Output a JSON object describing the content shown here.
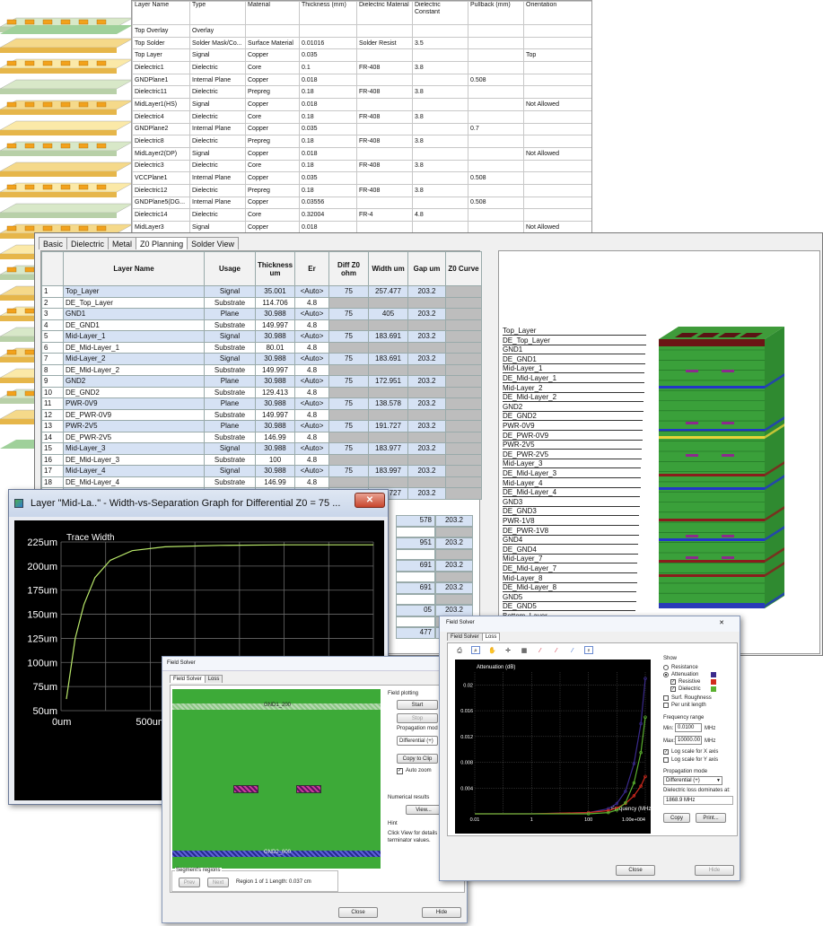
{
  "top_table": {
    "headers": [
      "Layer Name",
      "Type",
      "Material",
      "Thickness (mm)",
      "Dielectric Material",
      "Dielectric Constant",
      "Pullback (mm)",
      "Orientation"
    ],
    "rows": [
      [
        "Top Overlay",
        "Overlay",
        "",
        "",
        "",
        "",
        "",
        ""
      ],
      [
        "Top Solder",
        "Solder Mask/Co...",
        "Surface Material",
        "0.01016",
        "Solder Resist",
        "3.5",
        "",
        ""
      ],
      [
        "Top Layer",
        "Signal",
        "Copper",
        "0.035",
        "",
        "",
        "",
        "Top"
      ],
      [
        "Dielectric1",
        "Dielectric",
        "Core",
        "0.1",
        "FR-408",
        "3.8",
        "",
        ""
      ],
      [
        "GNDPlane1",
        "Internal Plane",
        "Copper",
        "0.018",
        "",
        "",
        "0.508",
        ""
      ],
      [
        "Dielectric11",
        "Dielectric",
        "Prepreg",
        "0.18",
        "FR-408",
        "3.8",
        "",
        ""
      ],
      [
        "MidLayer1(HS)",
        "Signal",
        "Copper",
        "0.018",
        "",
        "",
        "",
        "Not Allowed"
      ],
      [
        "Dielectric4",
        "Dielectric",
        "Core",
        "0.18",
        "FR-408",
        "3.8",
        "",
        ""
      ],
      [
        "GNDPlane2",
        "Internal Plane",
        "Copper",
        "0.035",
        "",
        "",
        "0.7",
        ""
      ],
      [
        "Dielectric8",
        "Dielectric",
        "Prepreg",
        "0.18",
        "FR-408",
        "3.8",
        "",
        ""
      ],
      [
        "MidLayer2(DP)",
        "Signal",
        "Copper",
        "0.018",
        "",
        "",
        "",
        "Not Allowed"
      ],
      [
        "Dielectric3",
        "Dielectric",
        "Core",
        "0.18",
        "FR-408",
        "3.8",
        "",
        ""
      ],
      [
        "VCCPlane1",
        "Internal Plane",
        "Copper",
        "0.035",
        "",
        "",
        "0.508",
        ""
      ],
      [
        "Dielectric12",
        "Dielectric",
        "Prepreg",
        "0.18",
        "FR-408",
        "3.8",
        "",
        ""
      ],
      [
        "GNDPlane5(DG...",
        "Internal Plane",
        "Copper",
        "0.03556",
        "",
        "",
        "0.508",
        ""
      ],
      [
        "Dielectric14",
        "Dielectric",
        "Core",
        "0.32004",
        "FR-4",
        "4.8",
        "",
        ""
      ],
      [
        "MidLayer3",
        "Signal",
        "Copper",
        "0.018",
        "",
        "",
        "",
        "Not Allowed"
      ]
    ]
  },
  "z0": {
    "tabs": [
      "Basic",
      "Dielectric",
      "Metal",
      "Z0 Planning",
      "Solder View"
    ],
    "headers": [
      "",
      "Layer Name",
      "Usage",
      "Thickness um",
      "Er",
      "Diff Z0 ohm",
      "Width um",
      "Gap um",
      "Z0 Curve"
    ],
    "rows": [
      [
        "1",
        "Top_Layer",
        "Signal",
        "35.001",
        "<Auto>",
        "75",
        "257.477",
        "203.2"
      ],
      [
        "2",
        "DE_Top_Layer",
        "Substrate",
        "114.706",
        "4.8",
        "",
        "",
        ""
      ],
      [
        "3",
        "GND1",
        "Plane",
        "30.988",
        "<Auto>",
        "75",
        "405",
        "203.2"
      ],
      [
        "4",
        "DE_GND1",
        "Substrate",
        "149.997",
        "4.8",
        "",
        "",
        ""
      ],
      [
        "5",
        "Mid-Layer_1",
        "Signal",
        "30.988",
        "<Auto>",
        "75",
        "183.691",
        "203.2"
      ],
      [
        "6",
        "DE_Mid-Layer_1",
        "Substrate",
        "80.01",
        "4.8",
        "",
        "",
        ""
      ],
      [
        "7",
        "Mid-Layer_2",
        "Signal",
        "30.988",
        "<Auto>",
        "75",
        "183.691",
        "203.2"
      ],
      [
        "8",
        "DE_Mid-Layer_2",
        "Substrate",
        "149.997",
        "4.8",
        "",
        "",
        ""
      ],
      [
        "9",
        "GND2",
        "Plane",
        "30.988",
        "<Auto>",
        "75",
        "172.951",
        "203.2"
      ],
      [
        "10",
        "DE_GND2",
        "Substrate",
        "129.413",
        "4.8",
        "",
        "",
        ""
      ],
      [
        "11",
        "PWR-0V9",
        "Plane",
        "30.988",
        "<Auto>",
        "75",
        "138.578",
        "203.2"
      ],
      [
        "12",
        "DE_PWR-0V9",
        "Substrate",
        "149.997",
        "4.8",
        "",
        "",
        ""
      ],
      [
        "13",
        "PWR-2V5",
        "Plane",
        "30.988",
        "<Auto>",
        "75",
        "191.727",
        "203.2"
      ],
      [
        "14",
        "DE_PWR-2V5",
        "Substrate",
        "146.99",
        "4.8",
        "",
        "",
        ""
      ],
      [
        "15",
        "Mid-Layer_3",
        "Signal",
        "30.988",
        "<Auto>",
        "75",
        "183.977",
        "203.2"
      ],
      [
        "16",
        "DE_Mid-Layer_3",
        "Substrate",
        "100",
        "4.8",
        "",
        "",
        ""
      ],
      [
        "17",
        "Mid-Layer_4",
        "Signal",
        "30.988",
        "<Auto>",
        "75",
        "183.997",
        "203.2"
      ],
      [
        "18",
        "DE_Mid-Layer_4",
        "Substrate",
        "146.99",
        "4.8",
        "",
        "",
        ""
      ],
      [
        "19",
        "GND3",
        "Plane",
        "30.988",
        "<Auto>",
        "75",
        "191.727",
        "203.2"
      ]
    ],
    "partial_rows": [
      [
        "578",
        "203.2"
      ],
      [
        "",
        ""
      ],
      [
        "951",
        "203.2"
      ],
      [
        "",
        ""
      ],
      [
        "691",
        "203.2"
      ],
      [
        "",
        ""
      ],
      [
        "691",
        "203.2"
      ],
      [
        "",
        ""
      ],
      [
        "05",
        "203.2"
      ],
      [
        "",
        ""
      ],
      [
        "477",
        "203.2"
      ]
    ],
    "stack_labels": [
      "Top_Layer",
      "DE_Top_Layer",
      "GND1",
      "DE_GND1",
      "Mid-Layer_1",
      "DE_Mid-Layer_1",
      "Mid-Layer_2",
      "DE_Mid-Layer_2",
      "GND2",
      "DE_GND2",
      "PWR-0V9",
      "DE_PWR-0V9",
      "PWR-2V5",
      "DE_PWR-2V5",
      "Mid-Layer_3",
      "DE_Mid-Layer_3",
      "Mid-Layer_4",
      "DE_Mid-Layer_4",
      "GND3",
      "DE_GND3",
      "PWR-1V8",
      "DE_PWR-1V8",
      "GND4",
      "DE_GND4",
      "Mid-Layer_7",
      "DE_Mid-Layer_7",
      "Mid-Layer_8",
      "DE_Mid-Layer_8",
      "GND5",
      "DE_GND5",
      "Bottom_Layer"
    ]
  },
  "graph_window": {
    "title": "Layer \"Mid-La..\" - Width-vs-Separation Graph for Differential Z0 = 75 ...",
    "close": "✕",
    "curve_label": "Trace Width",
    "chart_data": {
      "type": "line",
      "title": "",
      "xlabel": "",
      "ylabel": "",
      "y_ticks": [
        "225um",
        "200um",
        "175um",
        "150um",
        "125um",
        "100um",
        "75um",
        "50um"
      ],
      "x_ticks": [
        "0um",
        "500um",
        "1"
      ],
      "ylim": [
        50,
        225
      ],
      "series": [
        {
          "name": "Trace Width",
          "x": [
            0,
            40,
            80,
            130,
            200,
            300,
            450,
            700,
            1000,
            1500,
            2000
          ],
          "y": [
            62,
            125,
            160,
            188,
            206,
            216,
            220,
            221.5,
            222,
            222,
            222
          ]
        }
      ]
    }
  },
  "field_solver_1": {
    "title": "Field Solver",
    "tabs": [
      "Field Solver",
      "Loss"
    ],
    "top_plane": "GND1_200",
    "bottom_plane": "GND2_600",
    "field_plotting": "Field plotting",
    "start": "Start",
    "stop": "Stop",
    "propagation_mode": "Propagation mod",
    "differential": "Differential (+)",
    "copy_to_clip": "Copy to Clip",
    "auto_zoom": "Auto zoom",
    "numerical_results": "Numerical results",
    "view": "View...",
    "hint": "Hint",
    "hint_text_1": "Click View for details a",
    "hint_text_2": "terminator values.",
    "segment_regions": "Segment's regions",
    "prev": "Prev",
    "next": "Next",
    "region_text": "Region 1 of 1  Length: 0.037 cm",
    "close": "Close",
    "hide": "Hide"
  },
  "field_solver_2": {
    "title": "Field Solver",
    "tabs": [
      "Field Solver",
      "Loss"
    ],
    "show": "Show",
    "resistance": "Resistance",
    "attenuation": "Attenuation",
    "resistive": "Resistive",
    "dielectric": "Dielectric",
    "surf_roughness": "Surf. Roughness",
    "per_unit_length": "Per unit length",
    "frequency_range": "Frequency range",
    "min_label": "Min:",
    "min_value": "0.0100",
    "max_label": "Max:",
    "max_value": "10000.00",
    "mhz": "MHz",
    "log_x": "Log scale for X axis",
    "log_y": "Log scale for Y axis",
    "propagation_mode": "Propagation mode",
    "differential": "Differential (+)",
    "dominates_label": "Dielectric loss dominates at:",
    "dominates_value": "1868.9 MHz",
    "copy": "Copy",
    "print": "Print...",
    "close": "Close",
    "hide": "Hide",
    "colors": {
      "attenuation": "#3a2a8c",
      "resistive": "#d22a1e",
      "dielectric": "#5ab02f"
    },
    "chart_data": {
      "type": "line",
      "title": "",
      "ylabel": "Attenuation (dB)",
      "xlabel": "Frequency (MHz)",
      "x_ticks": [
        "0.01",
        "1",
        "100",
        "1.00e+004"
      ],
      "y_ticks": [
        "0.02",
        "0.016",
        "0.012",
        "0.008",
        "0.004"
      ],
      "x_scale": "log",
      "xlim": [
        0.01,
        10000
      ],
      "ylim": [
        0,
        0.022
      ],
      "series": [
        {
          "name": "Attenuation",
          "x": [
            0.01,
            1,
            100,
            500,
            1000,
            2000,
            4000,
            7000,
            10000
          ],
          "y": [
            0,
            0,
            0.0002,
            0.0008,
            0.0016,
            0.0035,
            0.0078,
            0.014,
            0.021
          ]
        },
        {
          "name": "Resistive",
          "x": [
            0.01,
            1,
            100,
            500,
            1000,
            2000,
            4000,
            7000,
            10000
          ],
          "y": [
            0,
            0,
            0.0002,
            0.0005,
            0.0009,
            0.0016,
            0.0028,
            0.0043,
            0.0058
          ]
        },
        {
          "name": "Dielectric",
          "x": [
            0.01,
            1,
            100,
            500,
            1000,
            2000,
            4000,
            7000,
            10000
          ],
          "y": [
            0,
            0,
            0,
            0.0002,
            0.0006,
            0.0017,
            0.0048,
            0.0095,
            0.015
          ]
        }
      ]
    }
  }
}
